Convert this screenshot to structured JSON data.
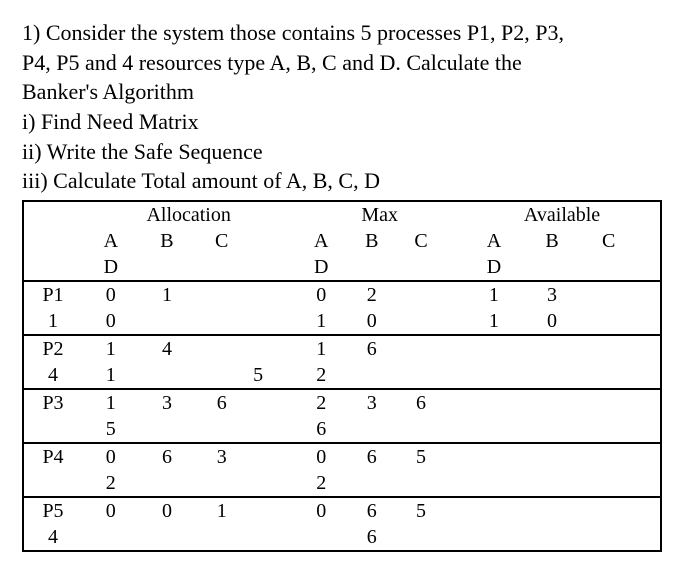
{
  "question": {
    "line1": "1) Consider the system those contains 5 processes P1, P2, P3,",
    "line2": "P4, P5 and 4 resources type A, B, C and D. Calculate the",
    "line3": "Banker's Algorithm",
    "part1": "i) Find Need Matrix",
    "part2": "ii) Write the Safe Sequence",
    "part3": "iii) Calculate Total amount of A, B, C, D"
  },
  "table": {
    "sections": {
      "alloc": "Allocation",
      "max": "Max",
      "avail": "Available"
    },
    "cols": {
      "A": "A",
      "B": "B",
      "C": "C",
      "D": "D"
    },
    "rows": [
      {
        "proc": "P1",
        "alloc": [
          "0",
          "1",
          "1",
          "0"
        ],
        "max": [
          "0",
          "2",
          "1",
          "0"
        ],
        "avail": [
          "1",
          "3",
          "1",
          "0"
        ]
      },
      {
        "proc": "P2",
        "alloc": [
          "1",
          "4",
          "4",
          "1"
        ],
        "max": [
          "1",
          "6",
          "5",
          "2"
        ],
        "avail": [
          "",
          "",
          "",
          ""
        ]
      },
      {
        "proc": "P3",
        "alloc": [
          "1",
          "3",
          "6",
          "5"
        ],
        "max": [
          "2",
          "3",
          "6",
          "6"
        ],
        "avail": [
          "",
          "",
          "",
          ""
        ]
      },
      {
        "proc": "P4",
        "alloc": [
          "0",
          "6",
          "3",
          "2"
        ],
        "max": [
          "0",
          "6",
          "5",
          "2"
        ],
        "avail": [
          "",
          "",
          "",
          ""
        ]
      },
      {
        "proc": "P5",
        "alloc": [
          "0",
          "0",
          "1",
          "4"
        ],
        "max": [
          "0",
          "6",
          "5",
          "6"
        ],
        "avail": [
          "",
          "",
          "",
          ""
        ]
      }
    ]
  },
  "chart_data": {
    "type": "table",
    "title": "Banker's Algorithm data",
    "columns": [
      "Process",
      "Alloc_A",
      "Alloc_B",
      "Alloc_C",
      "Alloc_D",
      "Max_A",
      "Max_B",
      "Max_C",
      "Max_D",
      "Avail_A",
      "Avail_B",
      "Avail_C",
      "Avail_D"
    ],
    "rows": [
      [
        "P1",
        0,
        1,
        1,
        0,
        0,
        2,
        1,
        0,
        1,
        3,
        1,
        0
      ],
      [
        "P2",
        1,
        4,
        4,
        1,
        1,
        6,
        5,
        2,
        null,
        null,
        null,
        null
      ],
      [
        "P3",
        1,
        3,
        6,
        5,
        2,
        3,
        6,
        6,
        null,
        null,
        null,
        null
      ],
      [
        "P4",
        0,
        6,
        3,
        2,
        0,
        6,
        5,
        2,
        null,
        null,
        null,
        null
      ],
      [
        "P5",
        0,
        0,
        1,
        4,
        0,
        6,
        5,
        6,
        null,
        null,
        null,
        null
      ]
    ]
  }
}
